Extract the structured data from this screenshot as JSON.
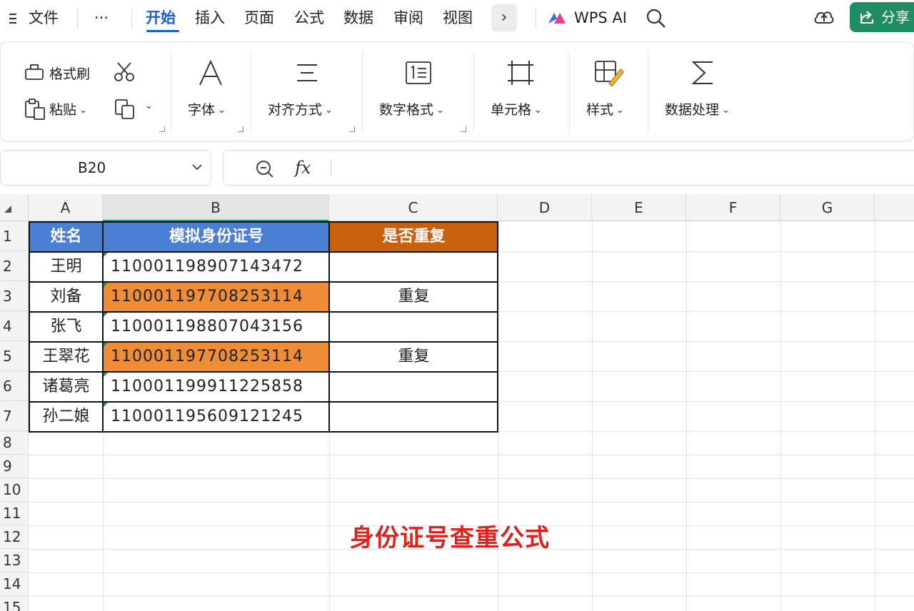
{
  "menubar": {
    "hamburger_label": "文件",
    "more_label": "···",
    "tabs": [
      "开始",
      "插入",
      "页面",
      "公式",
      "数据",
      "审阅",
      "视图"
    ],
    "more_tabs_chevron": "›",
    "wps_ai_label": "WPS AI",
    "share_label": "分享"
  },
  "ribbon": {
    "format_painter": "格式刷",
    "paste": "粘贴",
    "font": "字体",
    "align": "对齐方式",
    "number_format": "数字格式",
    "cells": "单元格",
    "styles": "样式",
    "data_processing": "数据处理",
    "caret": "⌄"
  },
  "formula_bar": {
    "cell_ref": "B20",
    "fx": "fx",
    "formula": ""
  },
  "grid": {
    "columns": [
      "A",
      "B",
      "C",
      "D",
      "E",
      "F",
      "G"
    ],
    "rows": [
      "1",
      "2",
      "3",
      "4",
      "5",
      "6",
      "7",
      "8",
      "9",
      "10",
      "11",
      "12",
      "13",
      "14",
      "15"
    ],
    "selected_column": "B"
  },
  "table": {
    "headers": [
      "姓名",
      "模拟身份证号",
      "是否重复"
    ],
    "rows": [
      {
        "name": "王明",
        "id": "110001198907143472",
        "dup": ""
      },
      {
        "name": "刘备",
        "id": "110001197708253114",
        "dup": "重复"
      },
      {
        "name": "张飞",
        "id": "110001198807043156",
        "dup": ""
      },
      {
        "name": "王翠花",
        "id": "110001197708253114",
        "dup": "重复"
      },
      {
        "name": "诸葛亮",
        "id": "110001199911225858",
        "dup": ""
      },
      {
        "name": "孙二娘",
        "id": "110001195609121245",
        "dup": ""
      }
    ],
    "colors": {
      "header_blue": "#4a7fd4",
      "header_orange": "#c8600e",
      "duplicate_fill": "#ef8d36"
    }
  },
  "annotation": "身份证号查重公式"
}
